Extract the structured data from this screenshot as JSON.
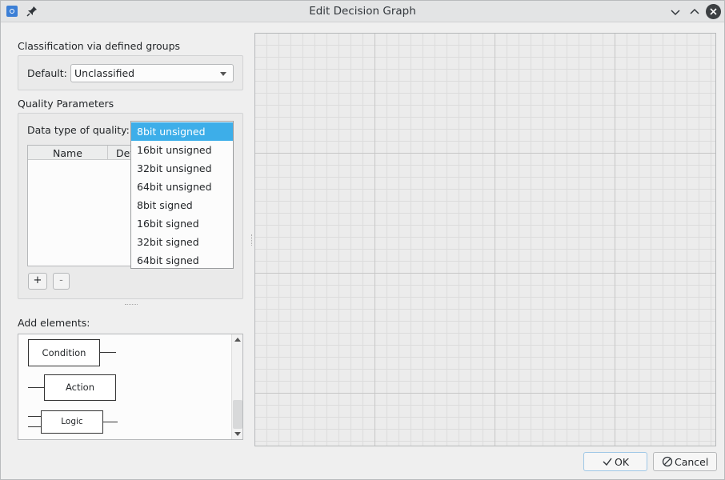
{
  "window": {
    "title": "Edit Decision Graph"
  },
  "classification": {
    "section_label": "Classification via defined groups",
    "default_label": "Default:",
    "default_value": "Unclassified"
  },
  "quality": {
    "section_label": "Quality Parameters",
    "data_type_label": "Data type of quality:",
    "table_headers": [
      "Name",
      "Def"
    ],
    "add_button": "+",
    "remove_button": "-",
    "dropdown_options": [
      "8bit unsigned",
      "16bit unsigned",
      "32bit unsigned",
      "64bit unsigned",
      "8bit signed",
      "16bit signed",
      "32bit signed",
      "64bit signed"
    ],
    "selected_option": "8bit unsigned"
  },
  "elements": {
    "section_label": "Add elements:",
    "items": [
      "Condition",
      "Action",
      "Logic"
    ]
  },
  "footer": {
    "ok_label": "OK",
    "cancel_label": "Cancel"
  },
  "colors": {
    "selection": "#3daee9",
    "titlebar": "#e3e4e5",
    "canvas_bg": "#ececec"
  }
}
